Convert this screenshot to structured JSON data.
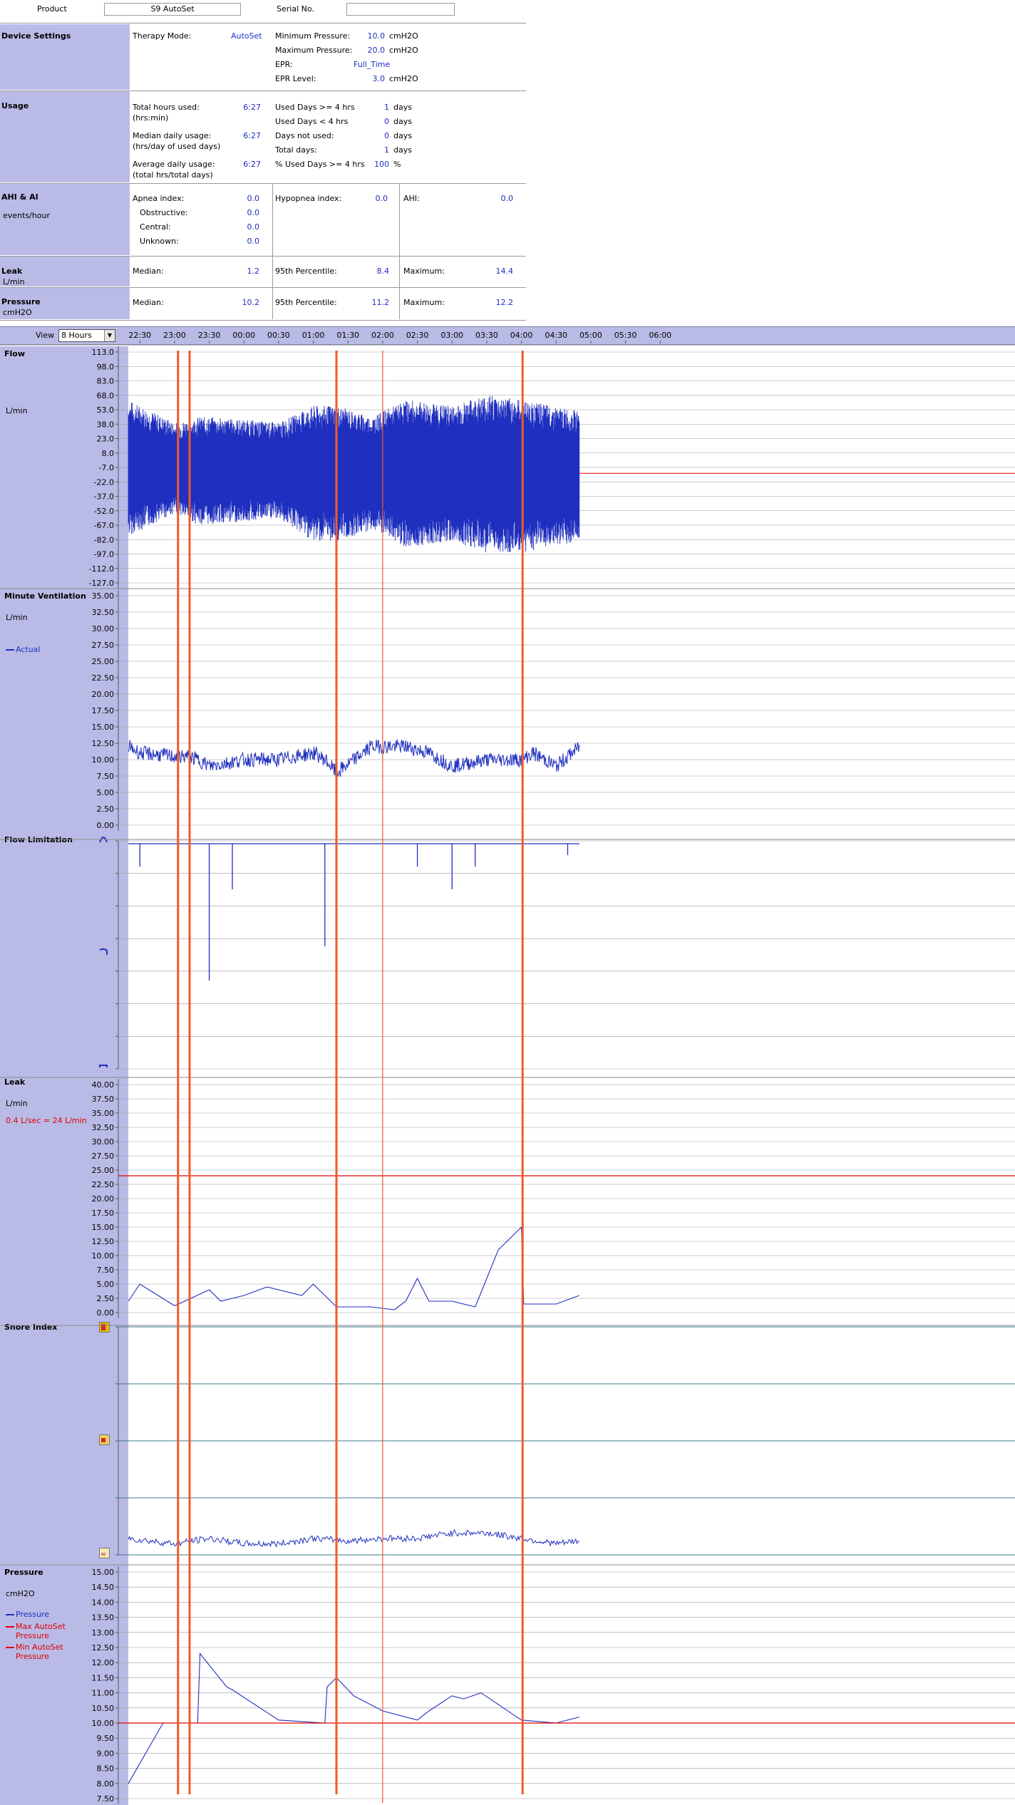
{
  "header": {
    "product_label": "Product",
    "product_value": "S9 AutoSet",
    "serial_label": "Serial No.",
    "serial_value": ""
  },
  "device_settings": {
    "title": "Device Settings",
    "therapy_mode_label": "Therapy Mode:",
    "therapy_mode_value": "AutoSet",
    "min_pressure_label": "Minimum Pressure:",
    "min_pressure_value": "10.0",
    "max_pressure_label": "Maximum Pressure:",
    "max_pressure_value": "20.0",
    "epr_label": "EPR:",
    "epr_value": "Full_Time",
    "epr_level_label": "EPR Level:",
    "epr_level_value": "3.0",
    "unit": "cmH2O"
  },
  "usage": {
    "title": "Usage",
    "total_hours_label": "Total hours used:",
    "total_hours_sub": "(hrs:min)",
    "total_hours_value": "6:27",
    "median_label": "Median daily usage:",
    "median_sub": "(hrs/day of used days)",
    "median_value": "6:27",
    "average_label": "Average daily usage:",
    "average_sub": "(total hrs/total days)",
    "average_value": "6:27",
    "used_ge4_label": "Used Days >= 4 hrs",
    "used_ge4_value": "1",
    "used_lt4_label": "Used Days < 4 hrs",
    "used_lt4_value": "0",
    "not_used_label": "Days not used:",
    "not_used_value": "0",
    "total_days_label": "Total days:",
    "total_days_value": "1",
    "pct_label": "% Used Days >= 4 hrs",
    "pct_value": "100",
    "days_unit": "days",
    "pct_unit": "%"
  },
  "ahi": {
    "title": "AHI & AI",
    "sub": "events/hour",
    "apnea_label": "Apnea index:",
    "apnea_value": "0.0",
    "obstructive_label": "Obstructive:",
    "obstructive_value": "0.0",
    "central_label": "Central:",
    "central_value": "0.0",
    "unknown_label": "Unknown:",
    "unknown_value": "0.0",
    "hypopnea_label": "Hypopnea index:",
    "hypopnea_value": "0.0",
    "ahi_label": "AHI:",
    "ahi_value": "0.0"
  },
  "leak_summary": {
    "title": "Leak",
    "unit": "L/min",
    "median_label": "Median:",
    "median_value": "1.2",
    "p95_label": "95th Percentile:",
    "p95_value": "8.4",
    "max_label": "Maximum:",
    "max_value": "14.4"
  },
  "pressure_summary": {
    "title": "Pressure",
    "unit": "cmH2O",
    "median_label": "Median:",
    "median_value": "10.2",
    "p95_label": "95th Percentile:",
    "p95_value": "11.2",
    "max_label": "Maximum:",
    "max_value": "12.2"
  },
  "timebar": {
    "view_label": "View",
    "view_value": "8 Hours",
    "times": [
      "22:30",
      "23:00",
      "23:30",
      "00:00",
      "00:30",
      "01:00",
      "01:30",
      "02:00",
      "02:30",
      "03:00",
      "03:30",
      "04:00",
      "04:30",
      "05:00",
      "05:30",
      "06:00"
    ]
  },
  "panels": {
    "flow": {
      "title": "Flow",
      "unit": "L/min",
      "ticks": [
        "113.0",
        "98.0",
        "83.0",
        "68.0",
        "53.0",
        "38.0",
        "23.0",
        "8.0",
        "-7.0",
        "-22.0",
        "-37.0",
        "-52.0",
        "-67.0",
        "-82.0",
        "-97.0",
        "-112.0",
        "-127.0"
      ]
    },
    "mv": {
      "title": "Minute Ventilation",
      "unit": "L/min",
      "legend": "Actual",
      "ticks": [
        "35.00",
        "32.50",
        "30.00",
        "27.50",
        "25.00",
        "22.50",
        "20.00",
        "17.50",
        "15.00",
        "12.50",
        "10.00",
        "7.50",
        "5.00",
        "2.50",
        "0.00"
      ]
    },
    "fl": {
      "title": "Flow Limitation"
    },
    "leak": {
      "title": "Leak",
      "unit": "L/min",
      "note": "0.4 L/sec = 24 L/min",
      "ticks": [
        "40.00",
        "37.50",
        "35.00",
        "32.50",
        "30.00",
        "27.50",
        "25.00",
        "22.50",
        "20.00",
        "17.50",
        "15.00",
        "12.50",
        "10.00",
        "7.50",
        "5.00",
        "2.50",
        "0.00"
      ]
    },
    "snore": {
      "title": "Snore Index"
    },
    "pressure": {
      "title": "Pressure",
      "unit": "cmH2O",
      "legend_pressure": "Pressure",
      "legend_max": "Max AutoSet Pressure",
      "legend_min": "Min AutoSet Pressure",
      "ticks": [
        "15.00",
        "14.50",
        "14.00",
        "13.50",
        "13.00",
        "12.50",
        "12.00",
        "11.50",
        "11.00",
        "10.50",
        "10.00",
        "9.50",
        "9.00",
        "8.50",
        "8.00",
        "7.50"
      ]
    }
  },
  "colors": {
    "panel": "#b9bbe6",
    "trace": "#1f2fbf",
    "marker": "#f05a28",
    "limit": "#e00000",
    "grid": "#9a9a9a"
  },
  "chart_data": [
    {
      "type": "area",
      "title": "Flow",
      "ylabel": "L/min",
      "xlabel": "",
      "ylim": [
        -127,
        128
      ],
      "x_range": [
        "22:20",
        "06:10"
      ],
      "grid": true,
      "series": [
        {
          "name": "",
          "note": "dense breath waveform 22:20–04:50, envelope",
          "x": [
            "22:20",
            "23:00",
            "23:20",
            "23:30",
            "00:30",
            "01:00",
            "01:20",
            "01:50",
            "02:20",
            "03:00",
            "03:30",
            "04:00",
            "04:50"
          ],
          "upper": [
            60,
            40,
            45,
            45,
            40,
            55,
            55,
            45,
            60,
            55,
            65,
            60,
            50
          ],
          "lower": [
            -60,
            -40,
            -50,
            -50,
            -45,
            -65,
            -65,
            -55,
            -70,
            -65,
            -75,
            -75,
            -65
          ]
        }
      ]
    },
    {
      "type": "line",
      "title": "Minute Ventilation",
      "ylabel": "L/min",
      "xlabel": "",
      "ylim": [
        0,
        35
      ],
      "grid": true,
      "series": [
        {
          "name": "Actual",
          "x": [
            "22:20",
            "22:30",
            "23:00",
            "23:10",
            "23:20",
            "23:30",
            "00:00",
            "00:30",
            "01:00",
            "01:10",
            "01:20",
            "01:50",
            "02:20",
            "02:40",
            "03:00",
            "03:30",
            "04:00",
            "04:10",
            "04:30",
            "04:50"
          ],
          "values": [
            12,
            11,
            10.5,
            10.5,
            10,
            9,
            10,
            10,
            11,
            10,
            8,
            12,
            12,
            11,
            9,
            10,
            10,
            11,
            9,
            12
          ]
        }
      ]
    },
    {
      "type": "line",
      "title": "Flow Limitation",
      "ylabel": "",
      "xlabel": "",
      "ylim": [
        0,
        1
      ],
      "grid": true,
      "series": [
        {
          "name": "",
          "note": "baseline near zero with intermittent spikes",
          "x": [
            "22:30",
            "23:30",
            "23:50",
            "01:10",
            "01:20",
            "02:30",
            "03:00",
            "03:20",
            "04:40"
          ],
          "values": [
            0.1,
            0.6,
            0.2,
            0.45,
            0.1,
            0.1,
            0.2,
            0.1,
            0.05
          ]
        }
      ]
    },
    {
      "type": "line",
      "title": "Leak",
      "ylabel": "L/min",
      "xlabel": "",
      "ylim": [
        0,
        40
      ],
      "grid": true,
      "series": [
        {
          "name": "",
          "x": [
            "22:20",
            "22:30",
            "23:00",
            "23:30",
            "23:40",
            "00:00",
            "00:20",
            "00:50",
            "01:00",
            "01:20",
            "01:50",
            "02:10",
            "02:20",
            "02:30",
            "02:40",
            "03:00",
            "03:20",
            "03:30",
            "03:40",
            "03:50",
            "04:00",
            "04:02",
            "04:30",
            "04:50"
          ],
          "values": [
            2,
            5,
            1.2,
            4,
            2,
            3,
            4.5,
            3,
            5,
            1,
            1,
            0.5,
            2,
            6,
            2,
            2,
            1,
            6,
            11,
            13,
            15,
            1.5,
            1.5,
            3
          ]
        },
        {
          "name": "0.4 L/sec = 24 L/min",
          "values": [
            24
          ]
        }
      ]
    },
    {
      "type": "line",
      "title": "Snore Index",
      "ylabel": "",
      "xlabel": "",
      "ylim": [
        0,
        4
      ],
      "grid": true,
      "series": [
        {
          "name": "",
          "x": [
            "22:20",
            "23:00",
            "23:30",
            "00:00",
            "00:30",
            "01:00",
            "01:30",
            "02:00",
            "02:30",
            "03:00",
            "03:30",
            "04:00",
            "04:30",
            "04:50"
          ],
          "values": [
            0.2,
            0.1,
            0.2,
            0.1,
            0.1,
            0.2,
            0.15,
            0.2,
            0.2,
            0.3,
            0.3,
            0.2,
            0.1,
            0.15
          ]
        }
      ]
    },
    {
      "type": "line",
      "title": "Pressure",
      "ylabel": "cmH2O",
      "xlabel": "",
      "ylim": [
        7.5,
        15
      ],
      "grid": true,
      "series": [
        {
          "name": "Pressure",
          "x": [
            "22:20",
            "22:50",
            "23:20",
            "23:22",
            "23:45",
            "23:50",
            "00:30",
            "01:10",
            "01:12",
            "01:20",
            "01:35",
            "02:00",
            "02:30",
            "02:40",
            "03:00",
            "03:10",
            "03:25",
            "04:00",
            "04:30",
            "04:50"
          ],
          "values": [
            8.0,
            10.0,
            10.0,
            12.3,
            11.2,
            11.1,
            10.1,
            10.0,
            11.2,
            11.5,
            10.9,
            10.4,
            10.1,
            10.4,
            10.9,
            10.8,
            11.0,
            10.1,
            10.0,
            10.2
          ]
        },
        {
          "name": "Max AutoSet Pressure",
          "values": [
            10.0
          ]
        },
        {
          "name": "Min AutoSet Pressure",
          "values": [
            10.0
          ]
        }
      ]
    }
  ]
}
